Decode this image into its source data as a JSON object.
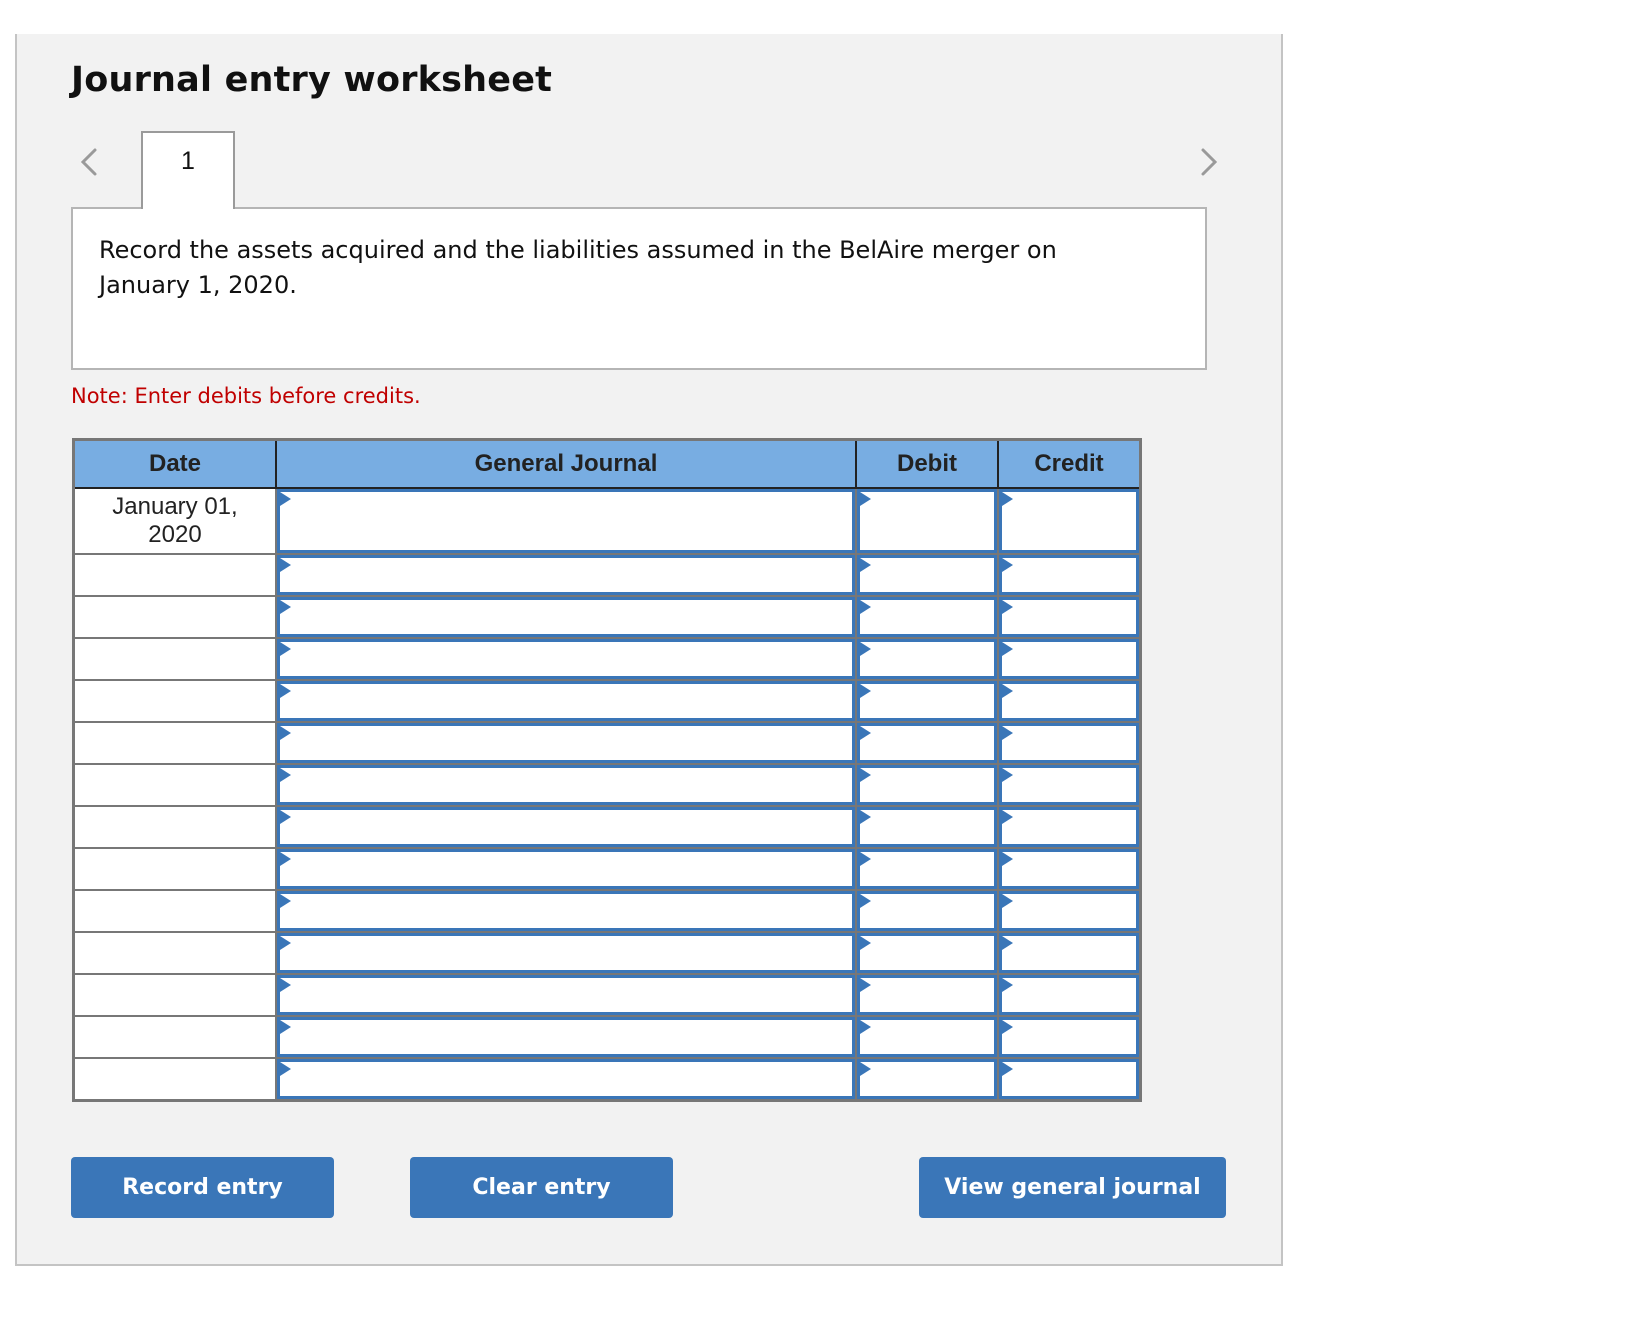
{
  "worksheet": {
    "title": "Journal entry worksheet",
    "nav": {
      "prev_icon": "chevron-left-icon",
      "next_icon": "chevron-right-icon"
    },
    "tabs": [
      {
        "label": "1",
        "active": true
      }
    ],
    "question": "Record the assets acquired and the liabilities assumed in the BelAire merger on January 1, 2020.",
    "note": "Note: Enter debits before credits."
  },
  "journal": {
    "headers": {
      "date": "Date",
      "general_journal": "General Journal",
      "debit": "Debit",
      "credit": "Credit"
    },
    "rows": [
      {
        "date": "January 01, 2020",
        "account": "",
        "debit": "",
        "credit": ""
      },
      {
        "date": "",
        "account": "",
        "debit": "",
        "credit": ""
      },
      {
        "date": "",
        "account": "",
        "debit": "",
        "credit": ""
      },
      {
        "date": "",
        "account": "",
        "debit": "",
        "credit": ""
      },
      {
        "date": "",
        "account": "",
        "debit": "",
        "credit": ""
      },
      {
        "date": "",
        "account": "",
        "debit": "",
        "credit": ""
      },
      {
        "date": "",
        "account": "",
        "debit": "",
        "credit": ""
      },
      {
        "date": "",
        "account": "",
        "debit": "",
        "credit": ""
      },
      {
        "date": "",
        "account": "",
        "debit": "",
        "credit": ""
      },
      {
        "date": "",
        "account": "",
        "debit": "",
        "credit": ""
      },
      {
        "date": "",
        "account": "",
        "debit": "",
        "credit": ""
      },
      {
        "date": "",
        "account": "",
        "debit": "",
        "credit": ""
      },
      {
        "date": "",
        "account": "",
        "debit": "",
        "credit": ""
      },
      {
        "date": "",
        "account": "",
        "debit": "",
        "credit": ""
      }
    ]
  },
  "buttons": {
    "record": "Record entry",
    "clear": "Clear entry",
    "view": "View general journal"
  },
  "colors": {
    "header_bg": "#78ade2",
    "button_bg": "#3a76b8",
    "input_border": "#3a76b8",
    "note_text": "#c00000",
    "panel_bg": "#f2f2f2"
  }
}
